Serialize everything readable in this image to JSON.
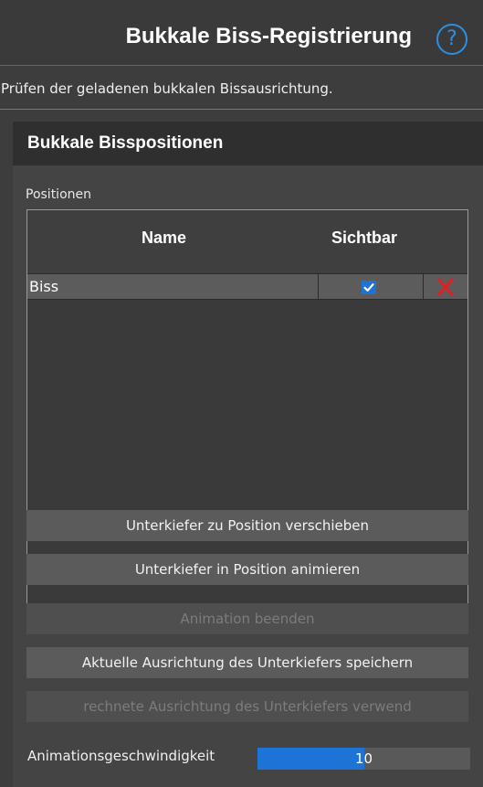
{
  "header": {
    "title": "Bukkale Biss-Registrierung",
    "help_icon": "question-circle-icon",
    "help_glyph": "?",
    "accent_color": "#2d8fe0"
  },
  "description": "Prüfen der geladenen bukkalen Bissausrichtung.",
  "section": {
    "title": "Bukkale Bisspositionen",
    "positions_label": "Positionen",
    "table": {
      "columns": [
        "Name",
        "Sichtbar"
      ],
      "rows": [
        {
          "name": "Biss",
          "visible": true,
          "delete_icon": "close-x-icon"
        }
      ]
    },
    "buttons": [
      {
        "label": "Unterkiefer zu Position verschieben",
        "enabled": true
      },
      {
        "label": "Unterkiefer in Position animieren",
        "enabled": true
      },
      {
        "label": "Animation beenden",
        "enabled": false
      },
      {
        "label": "Aktuelle Ausrichtung des Unterkiefers speichern",
        "enabled": true
      },
      {
        "label": "rechnete Ausrichtung des Unterkiefers verwend",
        "enabled": false
      }
    ],
    "animation_speed": {
      "label": "Animationsgeschwindigkeit",
      "value": "10",
      "fill_fraction": 0.5
    }
  },
  "colors": {
    "checkbox": "#1e73d6",
    "delete": "#e02020",
    "slider_fill": "#1e73d6"
  }
}
